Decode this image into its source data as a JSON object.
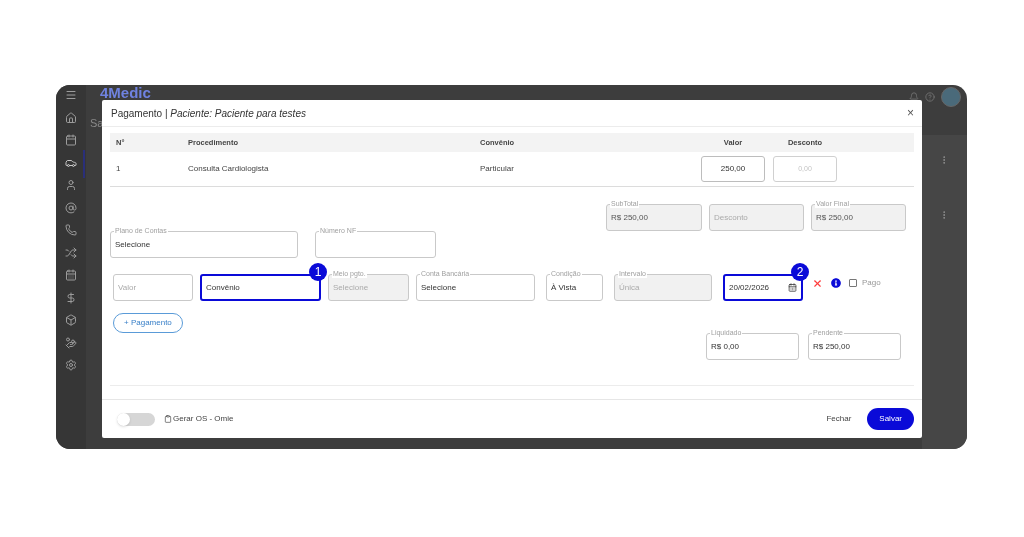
{
  "background": {
    "logo": "4Medic",
    "page_title": "Sa",
    "sidebar": [
      {
        "selected": false
      },
      {
        "selected": false
      },
      {
        "selected": false
      },
      {
        "selected": true
      },
      {
        "selected": false
      },
      {
        "selected": false
      },
      {
        "selected": false
      },
      {
        "selected": false
      },
      {
        "selected": false
      },
      {
        "selected": false
      },
      {
        "selected": false
      },
      {
        "selected": false
      },
      {
        "selected": false
      }
    ]
  },
  "modal": {
    "title": "Pagamento | *Paciente: Paciente para testes*",
    "close": "×",
    "table": {
      "columns": [
        "N°",
        "Procedimento",
        "Convênio",
        "Valor",
        "Desconto"
      ],
      "rows": [
        {
          "number": "1",
          "procedure": "Consulta Cardiologista",
          "plan": "Particular",
          "value": "250,00",
          "discount_placeholder": "0,00"
        }
      ]
    },
    "totals": [
      {
        "label": "SubTotal",
        "value": "R$ 250,00",
        "disabled": true
      },
      {
        "placeholder": "Desconto",
        "disabled": true
      },
      {
        "label": "Valor Final",
        "value": "R$ 250,00",
        "disabled": true
      }
    ],
    "account_fields": [
      {
        "label": "Plano de Contas",
        "value": "Selecione",
        "disabled": false
      },
      {
        "label": "Número NF",
        "disabled": false
      }
    ],
    "payment": {
      "fields": [
        {
          "kind": "text",
          "placeholder": "Valor",
          "disabled": false,
          "highlighted": false
        },
        {
          "kind": "text",
          "value": "Convênio",
          "disabled": false,
          "highlighted": true,
          "callout": "1"
        },
        {
          "kind": "text",
          "label": "Meio pgto.",
          "placeholder": "Selecione",
          "disabled": true,
          "highlighted": false
        },
        {
          "kind": "text",
          "label": "Conta Bancária",
          "value": "Selecione",
          "disabled": false,
          "highlighted": false
        },
        {
          "kind": "text",
          "label": "Condição",
          "value": "À Vista",
          "disabled": false,
          "highlighted": false
        },
        {
          "kind": "text",
          "label": "Intervalo",
          "placeholder": "Única",
          "disabled": true,
          "highlighted": false
        },
        {
          "kind": "date",
          "value": "20/02/2026",
          "disabled": false,
          "highlighted": true,
          "callout": "2"
        }
      ],
      "paid": {
        "label": "Pago",
        "checked": false
      }
    },
    "add_payment": "+ Pagamento",
    "balances": [
      {
        "label": "Liquidado",
        "value": "R$ 0,00"
      },
      {
        "label": "Pendente",
        "value": "R$ 250,00"
      }
    ],
    "footer": {
      "toggle": {
        "label": "Gerar OS - Omie",
        "on": false
      },
      "buttons": [
        "Fechar",
        "Salvar"
      ]
    }
  }
}
